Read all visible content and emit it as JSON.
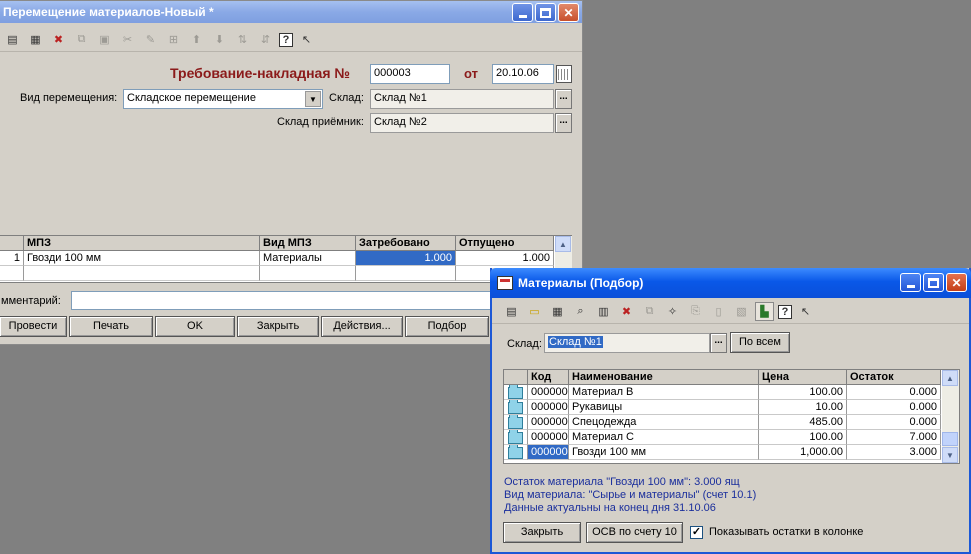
{
  "main_window": {
    "title": "Перемещение материалов-Новый *",
    "doc_title": "Требование-накладная №",
    "doc_number": "000003",
    "date_label": "от",
    "date_value": "20.10.06",
    "movement_type_label": "Вид перемещения:",
    "movement_type_value": "Складское перемещение",
    "warehouse_label": "Склад:",
    "warehouse_value": "Склад №1",
    "receiver_label": "Склад приёмник:",
    "receiver_value": "Склад №2",
    "table": {
      "headers": [
        "МПЗ",
        "Вид МПЗ",
        "Затребовано",
        "Отпущено"
      ],
      "rows": [
        {
          "num": "1",
          "mpz": "Гвозди 100 мм",
          "type": "Материалы",
          "requested": "1.000",
          "released": "1.000"
        }
      ]
    },
    "comment_label": "мментарий:",
    "buttons": {
      "post": "Провести",
      "print": "Печать",
      "ok": "OK",
      "close": "Закрыть",
      "actions": "Действия...",
      "select": "Подбор"
    }
  },
  "materials_window": {
    "title": "Материалы (Подбор)",
    "warehouse_label": "Склад:",
    "warehouse_value": "Склад №1",
    "all_button": "По всем",
    "table": {
      "headers": [
        "Код",
        "Наименование",
        "Цена",
        "Остаток"
      ],
      "rows": [
        {
          "code": "000000",
          "name": "Материал B",
          "price": "100.00",
          "rest": "0.000"
        },
        {
          "code": "000000",
          "name": "Рукавицы",
          "price": "10.00",
          "rest": "0.000"
        },
        {
          "code": "000000",
          "name": "Спецодежда",
          "price": "485.00",
          "rest": "0.000"
        },
        {
          "code": "000000",
          "name": "Материал C",
          "price": "100.00",
          "rest": "7.000"
        },
        {
          "code": "000000",
          "name": "Гвозди 100 мм",
          "price": "1,000.00",
          "rest": "3.000"
        }
      ]
    },
    "info_lines": [
      "Остаток материала \"Гвозди 100 мм\": 3.000 ящ",
      "Вид материала: \"Сырье и материалы\" (счет 10.1)",
      "Данные актуальны на конец дня 31.10.06"
    ],
    "close_button": "Закрыть",
    "osv_button": "ОСВ по счету 10",
    "show_rest_label": "Показывать остатки в колонке",
    "show_rest_checked": "✓"
  }
}
